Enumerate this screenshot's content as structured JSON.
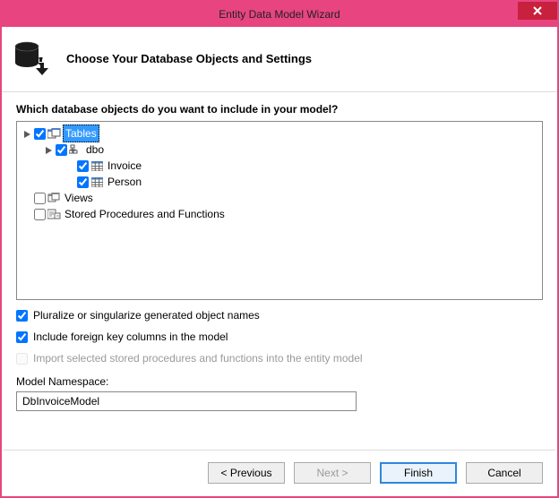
{
  "window": {
    "title": "Entity Data Model Wizard"
  },
  "header": {
    "heading": "Choose Your Database Objects and Settings"
  },
  "question": "Which database objects do you want to include in your model?",
  "tree": {
    "tables": {
      "label": "Tables",
      "checked": true,
      "children": {
        "dbo": {
          "label": "dbo",
          "checked": true,
          "items": [
            {
              "label": "Invoice",
              "checked": true
            },
            {
              "label": "Person",
              "checked": true
            }
          ]
        }
      }
    },
    "views": {
      "label": "Views",
      "checked": false
    },
    "procs": {
      "label": "Stored Procedures and Functions",
      "checked": false
    }
  },
  "options": {
    "pluralize": {
      "label": "Pluralize or singularize generated object names",
      "checked": true
    },
    "fk": {
      "label": "Include foreign key columns in the model",
      "checked": true
    },
    "sprocs": {
      "label": "Import selected stored procedures and functions into the entity model",
      "checked": false
    }
  },
  "namespace": {
    "label": "Model Namespace:",
    "value": "DbInvoiceModel"
  },
  "buttons": {
    "previous": "< Previous",
    "next": "Next >",
    "finish": "Finish",
    "cancel": "Cancel"
  }
}
